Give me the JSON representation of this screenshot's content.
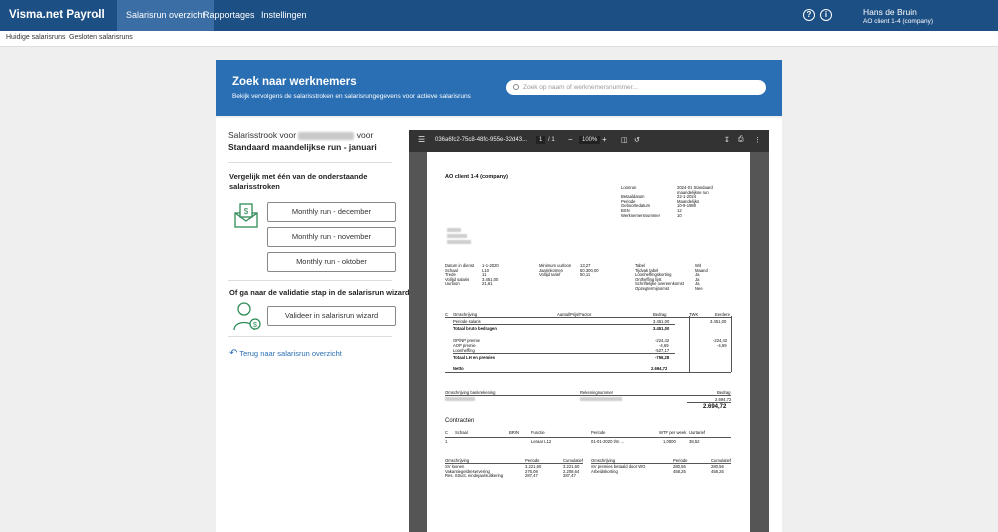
{
  "app": {
    "brand": "Visma.net Payroll"
  },
  "topnav": {
    "items": [
      "Salarisrun overzicht",
      "Rapportages",
      "Instellingen"
    ],
    "help_glyph": "?",
    "info_glyph": "i"
  },
  "user": {
    "name": "Hans de Bruin",
    "company": "AO client 1-4 (company)"
  },
  "subnav": {
    "tabs": [
      "Huidige salarisruns",
      "Gesloten salarisruns"
    ]
  },
  "banner": {
    "title": "Zoek naar werknemers",
    "subtitle": "Bekijk vervolgens de salarisstroken en salarisrungegevens voor actieve salarisruns",
    "search_placeholder": "Zoek op naam of werknemersnummer..."
  },
  "slip": {
    "prefix": "Salarisstrook voor",
    "suffix": "voor",
    "run_name": "Standaard maandelijkse run - januari"
  },
  "compare": {
    "title": "Vergelijk met één van de onderstaande salarisstroken",
    "runs": [
      "Monthly run - december",
      "Monthly run - november",
      "Monthly run - oktober"
    ]
  },
  "wizard": {
    "title": "Of ga naar de validatie stap in de salarisrun wizard",
    "button": "Valideer in salarisrun wizard"
  },
  "back_link": "Terug naar salarisrun overzicht",
  "viewer": {
    "filename": "036a6fc2-75c8-48fc-955e-32d43...",
    "page_current": "1",
    "page_total": "/ 1",
    "zoom": "100%"
  },
  "pdf": {
    "company": "AO client 1-4 (company)",
    "meta_labels": [
      "Loonrun",
      "",
      "Betaaldatum",
      "Periode",
      "Geboortedatum",
      "BSN",
      "Werknemersnummer"
    ],
    "meta_values": [
      "2024-01 Standaard",
      "maandelijkse run",
      "22-1-2024",
      "Maandelijks",
      "10-9-1980",
      "12",
      "10"
    ],
    "col1_labels": [
      "Datum in dienst",
      "Schaal",
      "Trede",
      "Vollijd salaris",
      "Uurloon"
    ],
    "col1_values": [
      "1-1-2020",
      "L10",
      "11",
      "3.451,00",
      "21,61"
    ],
    "col2_labels": [
      "Minimum uurloon",
      "Jaarinkomen",
      "Vollijd tarief"
    ],
    "col2_values": [
      "13,27",
      "50.300,00",
      "50,11"
    ],
    "col3_labels": [
      "Tabel",
      "Tijdvak tabel",
      "Loonheffingskorting",
      "Ontheffing lijst",
      "Schriftelijke overeenkomst",
      "Opzegtermijnomst"
    ],
    "col3_values": [
      "Wit",
      "Maand",
      "Ja",
      "Ja",
      "Ja",
      "Nee"
    ],
    "table_headers": [
      "C",
      "Omschrijving",
      "Aantal/Prijs/Factor",
      "Bedrag",
      "TWK",
      "Eerdere"
    ],
    "table_rows": [
      [
        "Periode salaris",
        "3.451,00",
        "3.451,00"
      ],
      [
        "Totaal bruto bedragen",
        "3.451,00",
        ""
      ],
      [
        "OP/NP premie",
        "-224,42",
        "-224,42"
      ],
      [
        "AOP premie",
        "-4,69",
        "-4,69"
      ],
      [
        "Loonheffing",
        "-527,17",
        ""
      ],
      [
        "Totaal LH en premies",
        "-756,28",
        ""
      ],
      [
        "Netto",
        "2.694,72",
        ""
      ]
    ],
    "bank_labels": [
      "Omschrijving bankrekening",
      "Rekeningnummer",
      "Bedrag"
    ],
    "bank_amount": "2.694,72",
    "bank_total": "2.694,72",
    "contracts_title": "Contracten",
    "contract_headers": [
      "C",
      "Schaal",
      "BRIN",
      "Functie",
      "Periode",
      "WTF per week",
      "Uurtarief"
    ],
    "contract_row": [
      "1",
      "Leraar L12",
      "01-01-2020 t/m ...",
      "1,0000",
      "38,52"
    ],
    "bottom_headers_left": [
      "Omschrijving",
      "Periode",
      "Cumulatief"
    ],
    "bottom_rows_left": [
      [
        "SV loonen",
        "3.221,60",
        "3.221,60"
      ],
      [
        "Vakantiegeldreservering",
        "276,08",
        "2.208,64"
      ],
      [
        "Res. Struct. eindejaarsuitkering",
        "287,47",
        "287,47"
      ]
    ],
    "bottom_headers_right": [
      "Omschrijving",
      "Periode",
      "Cumulatief"
    ],
    "bottom_rows_right": [
      [
        "SV premies betaald door WG",
        "280,56",
        "280,56"
      ],
      [
        "Arbeidskorting",
        "458,25",
        "458,25"
      ]
    ]
  }
}
